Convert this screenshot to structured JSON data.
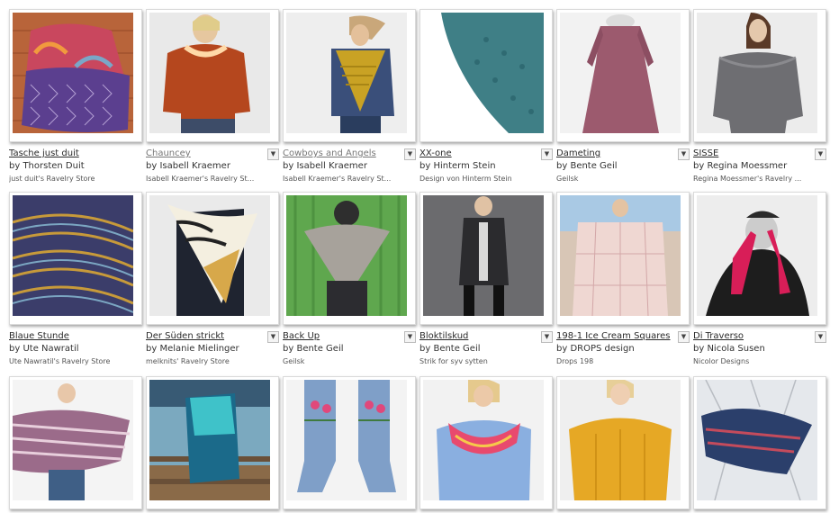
{
  "menu_glyph": "▼",
  "patterns": [
    {
      "title": "Tasche just duit",
      "by_prefix": "by",
      "designer": "Thorsten Duit",
      "store": "just duit's Ravelry Store",
      "has_menu": false,
      "muted": false
    },
    {
      "title": "Chauncey",
      "by_prefix": "by",
      "designer": "Isabell Kraemer",
      "store": "Isabell Kraemer's Ravelry St...",
      "has_menu": true,
      "muted": true
    },
    {
      "title": "Cowboys and Angels",
      "by_prefix": "by",
      "designer": "Isabell Kraemer",
      "store": "Isabell Kraemer's Ravelry St...",
      "has_menu": true,
      "muted": true
    },
    {
      "title": "XX-one",
      "by_prefix": "by",
      "designer": "Hinterm Stein",
      "store": "Design von Hinterm Stein",
      "has_menu": true,
      "muted": false
    },
    {
      "title": "Dameting",
      "by_prefix": "by",
      "designer": "Bente Geil",
      "store": "Geilsk",
      "has_menu": true,
      "muted": false
    },
    {
      "title": "SISSE",
      "by_prefix": "by",
      "designer": "Regina Moessmer",
      "store": "Regina Moessmer's Ravelry ...",
      "has_menu": true,
      "muted": false
    },
    {
      "title": "Blaue Stunde",
      "by_prefix": "by",
      "designer": "Ute Nawratil",
      "store": "Ute Nawratil's Ravelry Store",
      "has_menu": false,
      "muted": false
    },
    {
      "title": "Der Süden strickt",
      "by_prefix": "by",
      "designer": "Melanie Mielinger",
      "store": "melknits' Ravelry Store",
      "has_menu": true,
      "muted": false
    },
    {
      "title": "Back Up",
      "by_prefix": "by",
      "designer": "Bente Geil",
      "store": "Geilsk",
      "has_menu": true,
      "muted": false
    },
    {
      "title": "Bloktilskud",
      "by_prefix": "by",
      "designer": "Bente Geil",
      "store": "Strik for syv sytten",
      "has_menu": true,
      "muted": false
    },
    {
      "title": "198-1 Ice Cream Squares",
      "by_prefix": "by",
      "designer": "DROPS design",
      "store": "Drops 198",
      "has_menu": true,
      "muted": false
    },
    {
      "title": "Di Traverso",
      "by_prefix": "by",
      "designer": "Nicola Susen",
      "store": "Nicolor Designs",
      "has_menu": true,
      "muted": false
    },
    {
      "title": "",
      "by_prefix": "",
      "designer": "",
      "store": "",
      "has_menu": false,
      "muted": false
    },
    {
      "title": "",
      "by_prefix": "",
      "designer": "",
      "store": "",
      "has_menu": false,
      "muted": false
    },
    {
      "title": "",
      "by_prefix": "",
      "designer": "",
      "store": "",
      "has_menu": false,
      "muted": false
    },
    {
      "title": "",
      "by_prefix": "",
      "designer": "",
      "store": "",
      "has_menu": false,
      "muted": false
    },
    {
      "title": "",
      "by_prefix": "",
      "designer": "",
      "store": "",
      "has_menu": false,
      "muted": false
    },
    {
      "title": "",
      "by_prefix": "",
      "designer": "",
      "store": "",
      "has_menu": false,
      "muted": false
    }
  ],
  "colors": {
    "link": "#2a2a2a",
    "muted_link": "#777777",
    "thumb_border": "#dadada"
  }
}
